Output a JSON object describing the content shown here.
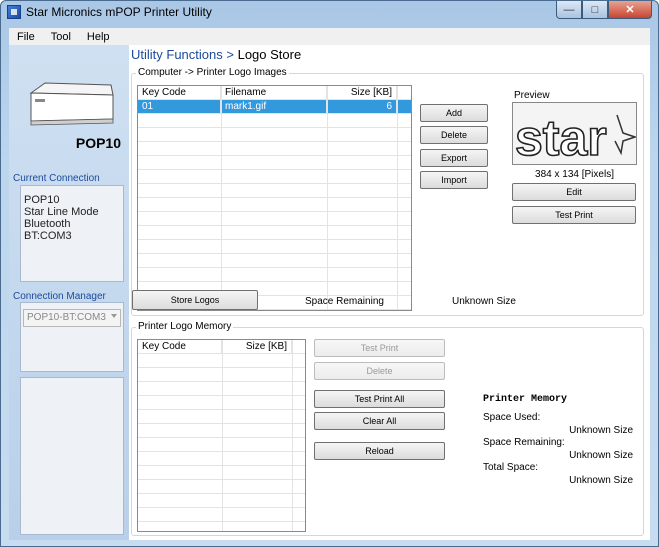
{
  "window": {
    "title": "Star Micronics mPOP Printer Utility"
  },
  "menu": {
    "items": [
      "File",
      "Tool",
      "Help"
    ]
  },
  "sidebar": {
    "printer_model": "POP10",
    "current_connection_label": "Current Connection",
    "connection_lines": [
      "POP10",
      "Star Line Mode",
      "Bluetooth",
      "BT:COM3"
    ],
    "connection_manager_label": "Connection Manager",
    "connection_select_value": "POP10-BT:COM3"
  },
  "breadcrumb": {
    "section": "Utility Functions",
    "separator": ">",
    "current": "Logo Store"
  },
  "computer_logos": {
    "title": "Computer -> Printer Logo Images",
    "columns": [
      "Key Code",
      "Filename",
      "Size [KB]"
    ],
    "rows": [
      {
        "key_code": "01",
        "filename": "mark1.gif",
        "size": "6"
      }
    ],
    "buttons": {
      "add": "Add",
      "delete": "Delete",
      "export": "Export",
      "import": "Import"
    },
    "preview_label": "Preview",
    "preview_logo_text": "star",
    "preview_size": "384 x 134 [Pixels]",
    "edit_button": "Edit",
    "test_print_button": "Test Print"
  },
  "store": {
    "store_logos_button": "Store Logos",
    "space_remaining_label": "Space Remaining",
    "space_remaining_value": "Unknown Size"
  },
  "printer_memory": {
    "group_title": "Printer Logo Memory",
    "columns": [
      "Key Code",
      "Size [KB]"
    ],
    "buttons": {
      "test_print": "Test Print",
      "delete": "Delete",
      "test_print_all": "Test Print All",
      "clear_all": "Clear All",
      "reload": "Reload"
    },
    "heading": "Printer Memory",
    "space_used_label": "Space Used:",
    "space_used_value": "Unknown Size",
    "space_remaining_label": "Space Remaining:",
    "space_remaining_value": "Unknown Size",
    "total_space_label": "Total Space:",
    "total_space_value": "Unknown Size"
  }
}
